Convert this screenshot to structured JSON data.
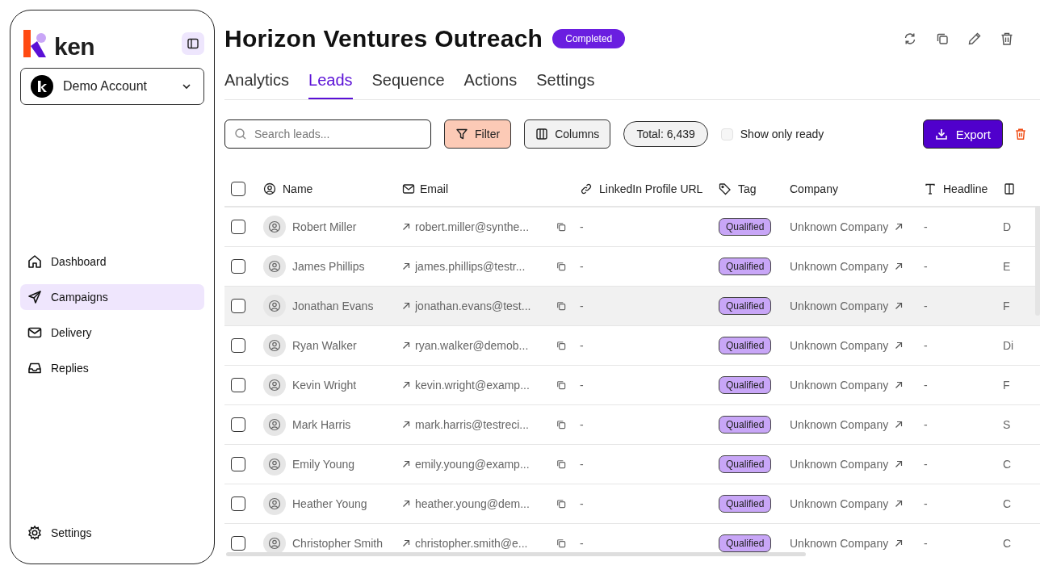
{
  "sidebar": {
    "brand": "ken",
    "account": "Demo Account",
    "nav": [
      {
        "label": "Dashboard",
        "selected": false
      },
      {
        "label": "Campaigns",
        "selected": true
      },
      {
        "label": "Delivery",
        "selected": false
      },
      {
        "label": "Replies",
        "selected": false
      }
    ],
    "footer": "Settings"
  },
  "header": {
    "title": "Horizon Ventures Outreach",
    "status": "Completed"
  },
  "tabs": [
    {
      "label": "Analytics",
      "selected": false
    },
    {
      "label": "Leads",
      "selected": true
    },
    {
      "label": "Sequence",
      "selected": false
    },
    {
      "label": "Actions",
      "selected": false
    },
    {
      "label": "Settings",
      "selected": false
    }
  ],
  "toolbar": {
    "search": {
      "placeholder": "Search leads..."
    },
    "filter": "Filter",
    "columns": "Columns",
    "total": "Total: 6,439",
    "show_only_ready": {
      "label": "Show only ready",
      "checked": false
    },
    "export": "Export"
  },
  "table": {
    "select_all": {
      "checked": false
    },
    "columns": [
      "Name",
      "Email",
      "LinkedIn Profile URL",
      "Tag",
      "Company",
      "Headline"
    ],
    "rows": [
      {
        "name": "Robert Miller",
        "email": "robert.miller@synthe...",
        "linkedin": "-",
        "tag": "Qualified",
        "company": "Unknown Company",
        "headline": "-",
        "column_7": "D",
        "checked": false,
        "highlighted": false
      },
      {
        "name": "James Phillips",
        "email": "james.phillips@testr...",
        "linkedin": "-",
        "tag": "Qualified",
        "company": "Unknown Company",
        "headline": "-",
        "column_7": "E",
        "checked": false,
        "highlighted": false
      },
      {
        "name": "Jonathan Evans",
        "email": "jonathan.evans@test...",
        "linkedin": "-",
        "tag": "Qualified",
        "company": "Unknown Company",
        "headline": "-",
        "column_7": "F",
        "checked": false,
        "highlighted": true
      },
      {
        "name": "Ryan Walker",
        "email": "ryan.walker@demob...",
        "linkedin": "-",
        "tag": "Qualified",
        "company": "Unknown Company",
        "headline": "-",
        "column_7": "Di",
        "checked": false,
        "highlighted": false
      },
      {
        "name": "Kevin Wright",
        "email": "kevin.wright@examp...",
        "linkedin": "-",
        "tag": "Qualified",
        "company": "Unknown Company",
        "headline": "-",
        "column_7": "F",
        "checked": false,
        "highlighted": false
      },
      {
        "name": "Mark Harris",
        "email": "mark.harris@testreci...",
        "linkedin": "-",
        "tag": "Qualified",
        "company": "Unknown Company",
        "headline": "-",
        "column_7": "S",
        "checked": false,
        "highlighted": false
      },
      {
        "name": "Emily Young",
        "email": "emily.young@examp...",
        "linkedin": "-",
        "tag": "Qualified",
        "company": "Unknown Company",
        "headline": "-",
        "column_7": "C",
        "checked": false,
        "highlighted": false
      },
      {
        "name": "Heather Young",
        "email": "heather.young@dem...",
        "linkedin": "-",
        "tag": "Qualified",
        "company": "Unknown Company",
        "headline": "-",
        "column_7": "C",
        "checked": false,
        "highlighted": false
      },
      {
        "name": "Christopher Smith",
        "email": "christopher.smith@e...",
        "linkedin": "-",
        "tag": "Qualified",
        "company": "Unknown Company",
        "headline": "-",
        "column_7": "C",
        "checked": false,
        "highlighted": false
      }
    ]
  }
}
